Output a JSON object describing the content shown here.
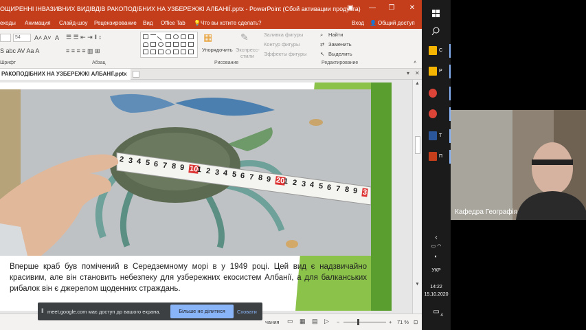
{
  "window": {
    "title": "ОЩИРЕННІ ІНВАЗИВНИХ ВИДІВДІВ РАКОПОДІБНИХ НА УЗБЕРЕЖЖІ АЛБАНІЇ.pptx - PowerPoint (Сбой активации продукта)"
  },
  "menu": {
    "items": [
      "еходы",
      "Анимация",
      "Слайд-шоу",
      "Рецензирование",
      "Вид",
      "Office Tab"
    ],
    "tell_me": "Что вы хотите сделать?",
    "login": "Вход",
    "share": "Общий доступ"
  },
  "ribbon": {
    "font_size": "54",
    "group_font": "Шрифт",
    "group_paragraph": "Абзац",
    "group_drawing": "Рисование",
    "group_editing": "Редактирование",
    "arrange": "Упорядочить",
    "quick_styles_1": "Экспресс-",
    "quick_styles_2": "стили",
    "shape_fill": "Заливка фигуры",
    "shape_outline": "Контур фигуры",
    "shape_effects": "Эффекты фигуры",
    "find": "Найти",
    "replace": "Заменить",
    "select": "Выделить"
  },
  "doc_tab": {
    "label": "РАКОПОДІБНИХ НА УЗБЕРЕЖЖІ АЛБАНІЇ.pptx"
  },
  "slide": {
    "text": "Вперше краб був помічений в Середземному морі в у 1949 році. Цей вид є надзвичайно красивим, але він становить небезпеку для узбережних екосистем Албанії, а для балканських рибалок він є джерелом щоденних страждань.",
    "tape_numbers": [
      "2",
      "3",
      "4",
      "5",
      "6",
      "7",
      "8",
      "9",
      "10",
      "1",
      "2",
      "3",
      "4",
      "5",
      "6",
      "7",
      "8",
      "9",
      "20",
      "1",
      "2",
      "3",
      "4",
      "5",
      "6",
      "7",
      "8",
      "9",
      "3"
    ]
  },
  "status": {
    "notes": "чания",
    "zoom": "71 %"
  },
  "share_bar": {
    "message": "meet.google.com має доступ до вашого екрана.",
    "stop_label": "Більше не ділитися",
    "hide_label": "Сховати"
  },
  "taskbar": {
    "apps": [
      {
        "label": "С",
        "color": "#f4b400"
      },
      {
        "label": "Р",
        "color": "#f4b400"
      },
      {
        "label": "",
        "color": "#db4437"
      },
      {
        "label": "",
        "color": "#db4437"
      },
      {
        "label": "Т",
        "color": "#2b579a"
      },
      {
        "label": "П",
        "color": "#c43e1c"
      }
    ],
    "lang": "УКР",
    "time": "14:22",
    "date": "15.10.2020",
    "notif_count": "4"
  },
  "video": {
    "name": "Кафедра Географія"
  },
  "colors": {
    "ppt_red": "#c43e1c",
    "slide_green": "#8bc34a",
    "meet_blue": "#8ab4f8"
  }
}
